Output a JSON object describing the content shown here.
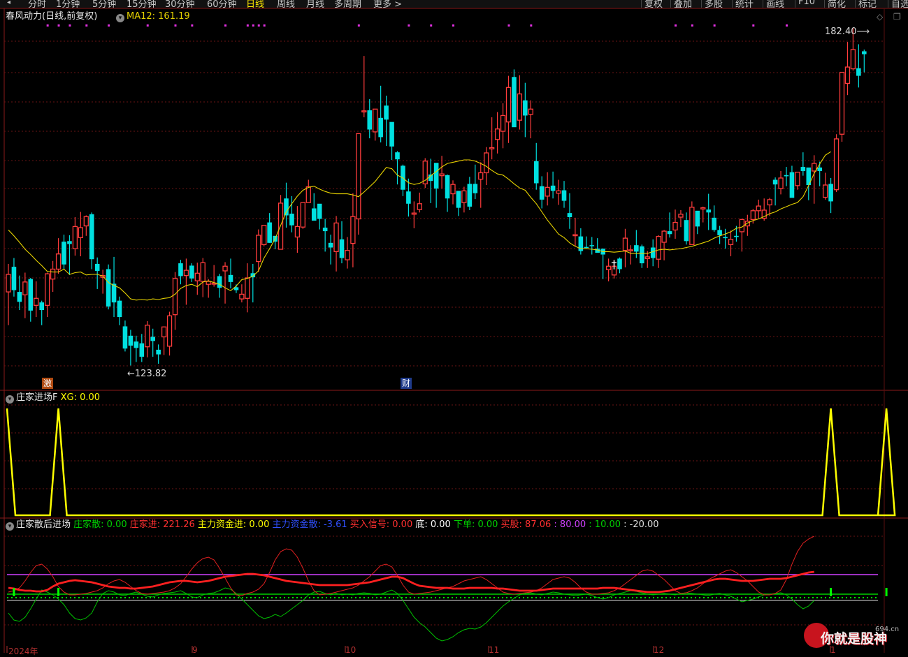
{
  "toolbar": {
    "left_icon": "◂",
    "periods": [
      "分时",
      "1分钟",
      "5分钟",
      "15分钟",
      "30分钟",
      "60分钟",
      "日线",
      "周线",
      "月线",
      "多周期",
      "更多 >"
    ],
    "active_period": "日线",
    "right_buttons": [
      "复权",
      "叠加",
      "多股",
      "统计",
      "画线",
      "F10",
      "简化",
      "标记",
      "自选"
    ]
  },
  "main_panel": {
    "name": "春风动力(日线,前复权)",
    "ma_label": "MA12: 161.19",
    "ma_color": "#e6d200",
    "high_label": "182.40",
    "low_label": "123.82",
    "badge_ji": "激",
    "badge_cai": "财"
  },
  "panel2": {
    "name": "庄家进场F",
    "xg_label": "XG: 0.00",
    "line_color": "#ffff00",
    "spikes": [
      1,
      9,
      148,
      158
    ]
  },
  "panel3": {
    "name": "庄家散后进场",
    "legend": [
      {
        "text": "庄家散: 0.00",
        "color": "#00d000"
      },
      {
        "text": "庄家进: 221.26",
        "color": "#ff3030"
      },
      {
        "text": "主力资金进: 0.00",
        "color": "#ffff00"
      },
      {
        "text": "主力资金散: -3.61",
        "color": "#3050ff"
      },
      {
        "text": "买入信号: 0.00",
        "color": "#ff3030"
      },
      {
        "text": "底: 0.00",
        "color": "#ffffff"
      },
      {
        "text": "下单: 0.00",
        "color": "#00d000"
      },
      {
        "text": "买股: 87.06",
        "color": "#ff3030"
      },
      {
        "text": ": 80.00",
        "color": "#d040ff"
      },
      {
        "text": ": 10.00",
        "color": "#00d000"
      },
      {
        "text": ": -20.00",
        "color": "#dddddd"
      }
    ]
  },
  "x_axis": {
    "dates": [
      "2024年",
      "9",
      "10",
      "11",
      "12",
      "1"
    ]
  },
  "watermark": {
    "url": "694.cn",
    "text": "你就是股神"
  },
  "colors": {
    "up": "#ff3c3c",
    "down": "#00e0e0",
    "grid": "#6a1515"
  },
  "chart_data": {
    "type": "candlestick",
    "ma": "MA12",
    "ma_last": 161.19,
    "high": 182.4,
    "low": 123.82,
    "price_axis": [
      123.82,
      182.4
    ],
    "ohlc": [
      [
        137.2,
        142.0,
        131.5,
        140.2
      ],
      [
        141.5,
        143.0,
        136.4,
        137.5
      ],
      [
        137.2,
        140.0,
        134.1,
        135.5
      ],
      [
        136.7,
        140.5,
        132.7,
        138.9
      ],
      [
        139.4,
        139.6,
        132.1,
        134.0
      ],
      [
        134.9,
        139.0,
        132.9,
        136.1
      ],
      [
        135.4,
        135.7,
        131.5,
        134.1
      ],
      [
        134.9,
        140.5,
        132.9,
        140.3
      ],
      [
        139.4,
        142.5,
        137.2,
        141.1
      ],
      [
        141.1,
        146.4,
        140.3,
        143.7
      ],
      [
        145.8,
        147.0,
        141.1,
        141.9
      ],
      [
        145.9,
        146.9,
        140.1,
        145.4
      ],
      [
        144.6,
        150.0,
        143.4,
        148.4
      ],
      [
        146.5,
        150.9,
        143.3,
        148.2
      ],
      [
        148.5,
        150.3,
        146.8,
        150.1
      ],
      [
        150.5,
        150.8,
        141.1,
        142.8
      ],
      [
        142.0,
        143.1,
        137.7,
        140.8
      ],
      [
        139.7,
        141.0,
        136.9,
        140.0
      ],
      [
        141.1,
        141.9,
        134.2,
        134.7
      ],
      [
        138.6,
        143.2,
        132.9,
        135.4
      ],
      [
        135.7,
        136.4,
        131.5,
        132.9
      ],
      [
        131.3,
        132.3,
        127.0,
        127.5
      ],
      [
        129.7,
        130.7,
        124.6,
        128.0
      ],
      [
        128.7,
        129.7,
        125.2,
        127.6
      ],
      [
        128.4,
        130.0,
        125.2,
        126.1
      ],
      [
        127.8,
        132.2,
        126.0,
        131.5
      ],
      [
        129.5,
        130.9,
        126.1,
        128.8
      ],
      [
        127.3,
        128.2,
        124.9,
        126.5
      ],
      [
        129.5,
        131.3,
        126.4,
        131.2
      ],
      [
        127.9,
        133.8,
        126.3,
        133.1
      ],
      [
        133.3,
        140.6,
        130.7,
        139.5
      ],
      [
        142.1,
        142.7,
        138.5,
        139.9
      ],
      [
        140.0,
        142.9,
        135.0,
        140.9
      ],
      [
        141.7,
        142.1,
        138.9,
        139.5
      ],
      [
        139.1,
        142.2,
        136.7,
        140.4
      ],
      [
        139.0,
        143.0,
        136.3,
        142.2
      ],
      [
        138.5,
        139.4,
        136.2,
        139.0
      ],
      [
        138.7,
        141.8,
        138.1,
        138.7
      ],
      [
        139.9,
        140.3,
        136.2,
        137.9
      ],
      [
        140.8,
        142.3,
        135.2,
        141.6
      ],
      [
        140.1,
        142.9,
        137.8,
        138.9
      ],
      [
        138.0,
        138.5,
        137.0,
        137.5
      ],
      [
        136.0,
        138.5,
        135.4,
        136.8
      ],
      [
        136.1,
        142.1,
        133.7,
        139.6
      ],
      [
        140.4,
        142.0,
        135.4,
        139.7
      ],
      [
        142.4,
        147.9,
        140.6,
        146.9
      ],
      [
        145.3,
        148.5,
        145.0,
        148.6
      ],
      [
        149.1,
        150.7,
        145.6,
        145.6
      ],
      [
        146.8,
        146.5,
        144.5,
        145.8
      ],
      [
        144.5,
        153.8,
        144.6,
        152.4
      ],
      [
        153.2,
        155.9,
        148.2,
        150.3
      ],
      [
        150.6,
        153.6,
        147.4,
        148.6
      ],
      [
        146.6,
        151.9,
        143.9,
        148.4
      ],
      [
        148.3,
        151.2,
        148.0,
        152.5
      ],
      [
        152.5,
        156.4,
        153.0,
        155.2
      ],
      [
        151.5,
        154.1,
        149.9,
        149.4
      ],
      [
        152.3,
        150.9,
        147.9,
        149.7
      ],
      [
        148.2,
        149.7,
        144.1,
        147.6
      ],
      [
        145.6,
        147.0,
        141.9,
        144.8
      ],
      [
        144.1,
        150.2,
        140.7,
        149.0
      ],
      [
        146.2,
        149.3,
        142.1,
        143.0
      ],
      [
        142.7,
        146.6,
        141.2,
        144.3
      ],
      [
        145.5,
        154.1,
        141.4,
        150.1
      ],
      [
        149.7,
        162.3,
        147.0,
        164.3
      ],
      [
        168.2,
        177.6,
        167.1,
        168.2
      ],
      [
        168.3,
        170.2,
        163.5,
        165.0
      ],
      [
        164.6,
        168.4,
        163.1,
        168.5
      ],
      [
        167.0,
        172.5,
        162.8,
        163.7
      ],
      [
        169.1,
        170.8,
        162.2,
        166.7
      ],
      [
        166.3,
        164.8,
        159.8,
        162.1
      ],
      [
        161.1,
        161.3,
        155.6,
        159.9
      ],
      [
        158.8,
        159.0,
        153.6,
        154.7
      ],
      [
        154.4,
        156.6,
        150.1,
        152.3
      ],
      [
        150.5,
        152.7,
        148.1,
        150.7
      ],
      [
        151.3,
        154.2,
        150.8,
        152.3
      ],
      [
        155.7,
        160.1,
        155.0,
        159.6
      ],
      [
        157.3,
        160.0,
        152.4,
        156.2
      ],
      [
        159.3,
        158.9,
        151.6,
        154.9
      ],
      [
        157.1,
        160.5,
        154.9,
        157.4
      ],
      [
        157.2,
        157.3,
        150.9,
        153.2
      ],
      [
        154.0,
        156.3,
        152.2,
        155.6
      ],
      [
        154.5,
        153.6,
        150.2,
        151.6
      ],
      [
        152.5,
        155.2,
        150.8,
        154.5
      ],
      [
        155.7,
        156.9,
        151.2,
        151.8
      ],
      [
        155.7,
        159.0,
        153.1,
        154.1
      ],
      [
        156.5,
        159.4,
        151.6,
        157.6
      ],
      [
        157.6,
        162.0,
        155.5,
        161.0
      ],
      [
        161.7,
        167.1,
        159.9,
        161.9
      ],
      [
        163.3,
        168.0,
        160.9,
        165.1
      ],
      [
        164.7,
        169.5,
        161.8,
        167.4
      ],
      [
        166.3,
        174.2,
        162.7,
        172.2
      ],
      [
        174.0,
        175.3,
        168.4,
        165.4
      ],
      [
        166.6,
        174.3,
        165.0,
        171.1
      ],
      [
        170.0,
        173.0,
        163.7,
        167.4
      ],
      [
        167.6,
        170.0,
        163.5,
        168.5
      ],
      [
        159.6,
        162.7,
        154.7,
        155.8
      ],
      [
        155.3,
        157.0,
        151.5,
        153.0
      ],
      [
        153.6,
        157.7,
        152.0,
        155.1
      ],
      [
        155.4,
        157.8,
        153.2,
        154.5
      ],
      [
        154.1,
        156.4,
        152.1,
        154.5
      ],
      [
        154.6,
        156.2,
        151.6,
        152.8
      ],
      [
        150.7,
        154.1,
        148.0,
        150.0
      ],
      [
        147.0,
        149.9,
        145.0,
        147.0
      ],
      [
        146.7,
        148.1,
        143.6,
        144.2
      ],
      [
        144.9,
        146.7,
        144.7,
        144.8
      ],
      [
        145.2,
        146.6,
        143.6,
        145.1
      ],
      [
        144.6,
        146.4,
        144.0,
        143.9
      ],
      [
        144.6,
        143.6,
        139.4,
        143.6
      ],
      [
        141.0,
        142.9,
        139.0,
        141.6
      ],
      [
        140.1,
        142.7,
        139.5,
        141.6
      ],
      [
        142.9,
        143.1,
        140.4,
        141.1
      ],
      [
        144.3,
        148.0,
        141.4,
        146.4
      ],
      [
        144.3,
        145.2,
        141.9,
        144.4
      ],
      [
        145.2,
        147.8,
        143.0,
        144.1
      ],
      [
        145.0,
        145.3,
        141.3,
        142.1
      ],
      [
        142.9,
        144.2,
        141.3,
        143.2
      ],
      [
        144.8,
        146.2,
        141.6,
        143.0
      ],
      [
        142.8,
        146.9,
        141.3,
        146.7
      ],
      [
        145.7,
        147.8,
        142.6,
        147.6
      ],
      [
        147.6,
        150.8,
        146.5,
        147.1
      ],
      [
        147.8,
        151.3,
        146.3,
        149.1
      ],
      [
        150.0,
        151.2,
        148.3,
        150.5
      ],
      [
        149.5,
        150.8,
        145.3,
        145.9
      ],
      [
        145.3,
        152.7,
        145.3,
        151.7
      ],
      [
        151.1,
        151.0,
        147.1,
        148.4
      ],
      [
        151.4,
        151.8,
        149.1,
        151.6
      ],
      [
        151.3,
        154.0,
        147.8,
        150.8
      ],
      [
        149.9,
        152.0,
        147.5,
        147.8
      ],
      [
        147.8,
        148.5,
        145.4,
        146.9
      ],
      [
        146.6,
        148.0,
        144.6,
        146.4
      ],
      [
        145.3,
        147.7,
        143.3,
        146.2
      ],
      [
        146.8,
        148.5,
        145.8,
        146.6
      ],
      [
        147.5,
        149.4,
        144.1,
        149.6
      ],
      [
        148.5,
        150.4,
        146.8,
        149.3
      ],
      [
        149.6,
        151.4,
        148.9,
        151.1
      ],
      [
        151.1,
        153.0,
        149.8,
        151.9
      ],
      [
        149.8,
        153.2,
        149.4,
        151.2
      ],
      [
        152.1,
        153.3,
        150.2,
        153.0
      ],
      [
        156.4,
        156.8,
        152.0,
        155.6
      ],
      [
        154.9,
        157.9,
        153.9,
        156.7
      ],
      [
        157.2,
        158.6,
        155.3,
        157.0
      ],
      [
        157.7,
        158.8,
        154.5,
        153.3
      ],
      [
        155.4,
        157.4,
        154.7,
        157.7
      ],
      [
        158.6,
        161.1,
        157.1,
        157.9
      ],
      [
        158.5,
        158.3,
        152.9,
        155.5
      ],
      [
        157.9,
        160.6,
        152.3,
        159.2
      ],
      [
        158.5,
        159.5,
        155.3,
        157.9
      ],
      [
        153.4,
        157.6,
        153.0,
        155.5
      ],
      [
        155.7,
        156.7,
        150.7,
        152.7
      ],
      [
        154.7,
        164.2,
        154.3,
        163.4
      ],
      [
        164.2,
        172.5,
        162.9,
        174.8
      ],
      [
        172.9,
        180.0,
        170.9,
        175.7
      ],
      [
        175.4,
        182.4,
        175.1,
        178.7
      ],
      [
        175.5,
        179.6,
        172.2,
        174.2
      ],
      [
        178.4,
        178.7,
        174.8,
        177.9
      ]
    ],
    "ma12": [
      147.8,
      146.8,
      145.7,
      144.5,
      143.6,
      142.6,
      141.7,
      140.7,
      140.6,
      140.6,
      141.1,
      140.2,
      140.5,
      140.6,
      140.1,
      140.2,
      140.2,
      139.9,
      138.8,
      138.3,
      137.9,
      137.0,
      136.0,
      135.8,
      135.9,
      135.8,
      136.0,
      135.9,
      136.1,
      136.2,
      136.8,
      137.8,
      138.3,
      138.5,
      138.1,
      138.9,
      139.1,
      138.8,
      138.5,
      137.9,
      137.4,
      138.2,
      139.3,
      139.5,
      139.9,
      140.8,
      143.0,
      144.6,
      146.3,
      148.6,
      150.9,
      152.3,
      153.6,
      154.6,
      155.1,
      155.3,
      154.8,
      154.4,
      154.1,
      154.0,
      154.0,
      154.0,
      153.8,
      153.5,
      154.3,
      155.2,
      156.1,
      157.3,
      158.5,
      158.3,
      157.2,
      156.7,
      155.9,
      155.6,
      155.8,
      156.3,
      157.1,
      157.8,
      158.6,
      159.2,
      159.4,
      159.6,
      159.8,
      159.8,
      159.6,
      159.2,
      158.7,
      158.0,
      157.4,
      157.2,
      156.5,
      155.7,
      155.0,
      154.6,
      153.4,
      152.3,
      150.9,
      149.5,
      148.3,
      147.1,
      146.5,
      145.6,
      145.0,
      144.6,
      144.6,
      144.5,
      144.4,
      144.1,
      144.1,
      144.0,
      144.1,
      144.2,
      143.8,
      143.8,
      143.8,
      143.8,
      144.1,
      144.4,
      144.5,
      144.4,
      144.5,
      144.6,
      144.8,
      145.0,
      145.3,
      145.6,
      145.9,
      146.4,
      146.8,
      147.1,
      147.5,
      148.1,
      148.3,
      149.0,
      149.4,
      149.7,
      150.1,
      150.6,
      150.9,
      151.4,
      151.8,
      152.2,
      152.5,
      153.5,
      155.4,
      157.5,
      159.1,
      160.6,
      161.2
    ],
    "panel3_series": {
      "series": [
        {
          "name": "庄家进",
          "color": "#ff3030"
        },
        {
          "name": "庄家散",
          "color": "#00d000"
        },
        {
          "name": "买股",
          "color": "#ff3030"
        }
      ],
      "levels": [
        {
          "value": 80,
          "color": "#d040ff"
        },
        {
          "value": 10,
          "color": "#00d000"
        },
        {
          "value": 0,
          "color": "#ffff00"
        },
        {
          "value": -20,
          "color": "#dddddd"
        }
      ]
    }
  }
}
